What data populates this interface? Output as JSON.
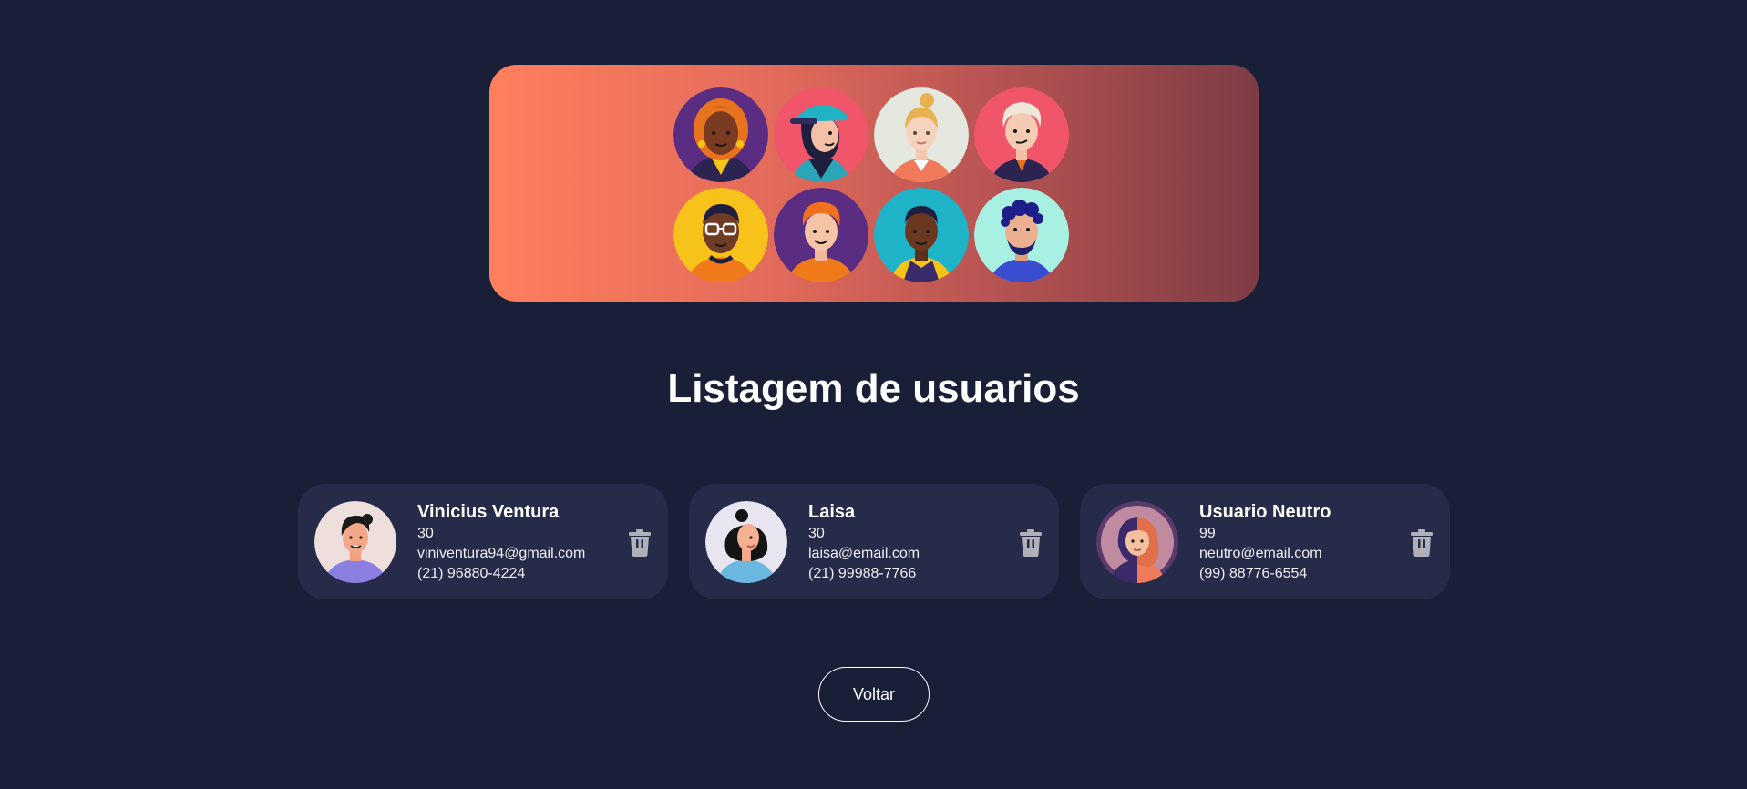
{
  "page": {
    "title": "Listagem de usuarios",
    "back_label": "Voltar"
  },
  "hero": {
    "avatars": [
      "woman-curly-hair",
      "woman-cap",
      "woman-blonde",
      "man-white-hair",
      "man-glasses",
      "man-redhead",
      "man-dark-skin",
      "man-beard"
    ]
  },
  "users": [
    {
      "name": "Vinicius Ventura",
      "age": "30",
      "email": "viniventura94@gmail.com",
      "phone": "(21) 96880-4224",
      "avatar": "man-avatar-icon"
    },
    {
      "name": "Laisa",
      "age": "30",
      "email": "laisa@email.com",
      "phone": "(21) 99988-7766",
      "avatar": "woman-avatar-icon"
    },
    {
      "name": "Usuario Neutro",
      "age": "99",
      "email": "neutro@email.com",
      "phone": "(99) 88776-6554",
      "avatar": "neutral-avatar-icon"
    }
  ],
  "colors": {
    "background": "#1a1f38",
    "card": "#252b48",
    "hero_start": "#ff7f5d",
    "hero_end": "#7e3c45"
  }
}
